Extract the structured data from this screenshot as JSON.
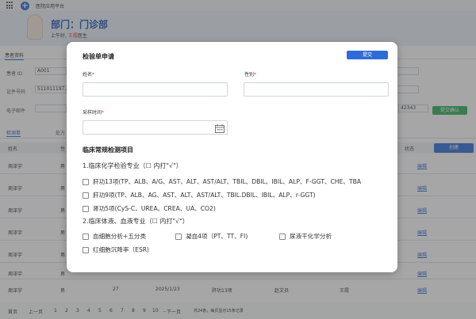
{
  "app": {
    "platform_name": "医院应用平台"
  },
  "header": {
    "dept_label": "部门：门诊部",
    "greeting_prefix": "上午好,",
    "doctor_name": "王霞",
    "greeting_suffix": "医生"
  },
  "patient_section": {
    "title": "患者资料",
    "patient_id_label": "患者 ID",
    "patient_id_value": "A001",
    "id_type_label": "证件号码",
    "id_value": "511011197...",
    "email_label": "电子邮件",
    "partial_number": "42343",
    "confirm_button": "提交确认"
  },
  "tabs": [
    {
      "label": "检测单"
    },
    {
      "label": "处方"
    }
  ],
  "table": {
    "headers": {
      "name": "姓名",
      "gender": "性",
      "status": "状态"
    },
    "create_button": "创建",
    "rows": [
      {
        "name": "周泽宇",
        "gender": "男",
        "edit": "编辑"
      },
      {
        "name": "周泽宇",
        "gender": "男",
        "edit": "编辑"
      },
      {
        "name": "周泽宇",
        "gender": "男",
        "edit": "编辑"
      },
      {
        "name": "周泽宇",
        "gender": "男",
        "edit": "编辑"
      },
      {
        "name": "周泽宇",
        "gender": "男",
        "edit": "编辑"
      },
      {
        "name": "周泽宇",
        "gender": "男",
        "edit": "编辑"
      },
      {
        "name": "周泽宇",
        "gender": "男",
        "age": "27",
        "date": "2025/1/23",
        "test": "肝功13项",
        "doctor": "赵文员",
        "nurse": "王霞",
        "edit": "编辑"
      }
    ]
  },
  "pagination": {
    "first": "首页",
    "prev": "上一页",
    "pages": [
      "1",
      "2",
      "3",
      "4",
      "5",
      "6",
      "7",
      "8",
      "9",
      "10",
      "..."
    ],
    "next": "下一页",
    "summary": "共24条，每页显示15条记录"
  },
  "modal": {
    "title": "检验单申请",
    "submit_button": "提交",
    "name_label": "姓名",
    "gender_label": "性别",
    "sample_time_label": "采样时间",
    "required_mark": "*",
    "section_title": "临床常规检测项目",
    "chem_heading": "1.临床化学检验专业（☐ 内打\"√\"）",
    "chem_items": [
      {
        "label": "肝功13项(TP、ALB、A/G、AST、ALT、AST/ALT、TBIL、DBIL、IBIL、ALP、F-GGT、CHE、TBA"
      },
      {
        "label": "肝功9项(TP、ALB、AG、AST、ALT、AST/ALT、TBIL.DBIL、IBIL、ALP、r-GGT)"
      },
      {
        "label": "肾功5项(CyS-C、UREA、CREA、UA、CO2)"
      }
    ],
    "body_fluid_heading": "2.临床体液、血液专业（☐ 内打\"√\"）",
    "body_fluid_items": [
      {
        "label": "血细胞分析+五分类"
      },
      {
        "label": "凝血4项（PT、TT、FI)"
      },
      {
        "label": "尿液干化学分析"
      },
      {
        "label": "红细胞沉降率（ESR)"
      }
    ]
  }
}
